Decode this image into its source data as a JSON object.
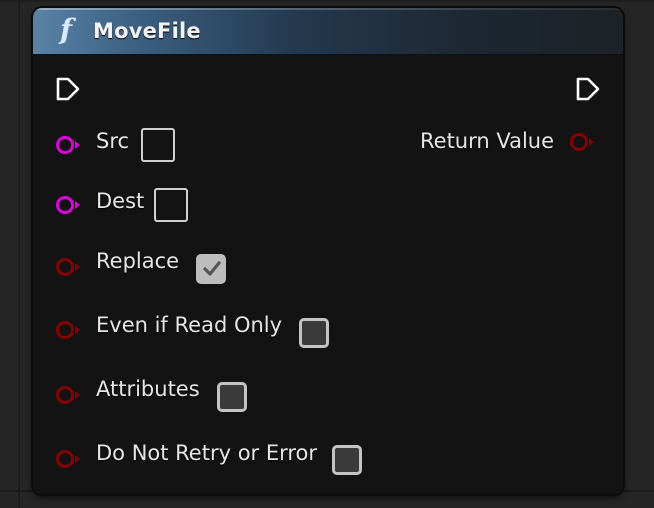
{
  "node": {
    "title": "MoveFile",
    "icon": "function-icon",
    "header_color": "#3b5f80"
  },
  "inputs": [
    {
      "label": "Src",
      "pin_type": "string",
      "pin_color": "#e000e0",
      "control": "text-box"
    },
    {
      "label": "Dest",
      "pin_type": "string",
      "pin_color": "#e000e0",
      "control": "text-box"
    },
    {
      "label": "Replace",
      "pin_type": "bool",
      "pin_color": "#8a0000",
      "control": "checkbox",
      "checked": true
    },
    {
      "label": "Even if Read Only",
      "pin_type": "bool",
      "pin_color": "#8a0000",
      "control": "checkbox",
      "checked": false
    },
    {
      "label": "Attributes",
      "pin_type": "bool",
      "pin_color": "#8a0000",
      "control": "checkbox",
      "checked": false
    },
    {
      "label": "Do Not Retry or Error",
      "pin_type": "bool",
      "pin_color": "#8a0000",
      "control": "checkbox",
      "checked": false
    }
  ],
  "outputs": [
    {
      "label": "Return Value",
      "pin_type": "bool",
      "pin_color": "#8a0000"
    }
  ]
}
